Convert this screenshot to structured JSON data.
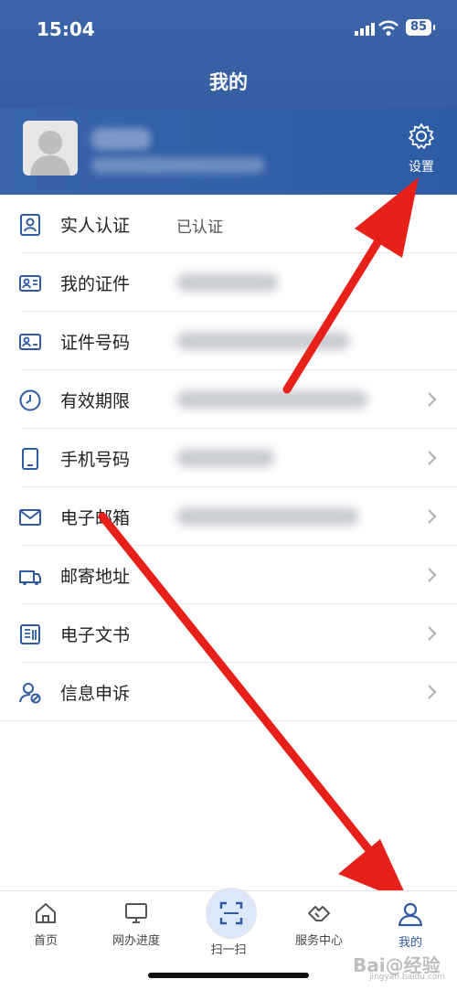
{
  "status_bar": {
    "time": "15:04",
    "battery": "85"
  },
  "header": {
    "title": "我的",
    "settings_label": "设置"
  },
  "list": {
    "items": [
      {
        "label": "实人认证",
        "value": "已认证",
        "icon": "id-card-icon"
      },
      {
        "label": "我的证件",
        "icon": "certificate-icon"
      },
      {
        "label": "证件号码",
        "icon": "id-number-icon"
      },
      {
        "label": "有效期限",
        "icon": "clock-icon"
      },
      {
        "label": "手机号码",
        "icon": "phone-icon"
      },
      {
        "label": "电子邮箱",
        "icon": "mail-icon"
      },
      {
        "label": "邮寄地址",
        "icon": "truck-icon"
      },
      {
        "label": "电子文书",
        "icon": "document-icon"
      },
      {
        "label": "信息申诉",
        "icon": "user-appeal-icon"
      }
    ]
  },
  "tabbar": {
    "tabs": [
      {
        "label": "首页",
        "icon": "home-icon"
      },
      {
        "label": "网办进度",
        "icon": "monitor-icon"
      },
      {
        "label": "扫一扫",
        "icon": "scan-icon"
      },
      {
        "label": "服务中心",
        "icon": "handshake-icon"
      },
      {
        "label": "我的",
        "icon": "user-icon",
        "active": true
      }
    ]
  },
  "watermark": {
    "text": "Bai@经验",
    "sub": "jingyan.baidu.com"
  },
  "colors": {
    "primary": "#2f5aa0",
    "arrow": "#e8201a"
  }
}
